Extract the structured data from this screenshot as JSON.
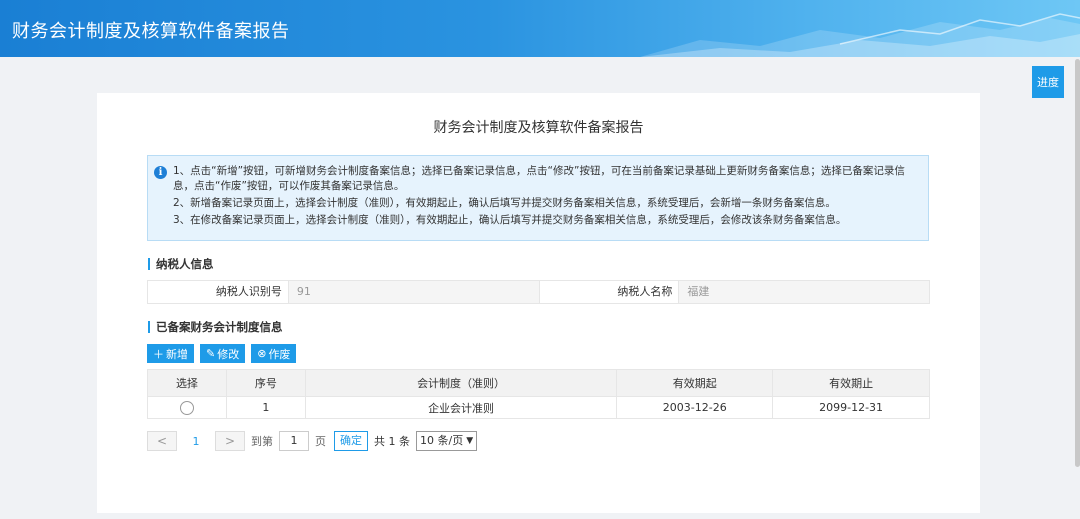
{
  "header": {
    "title": "财务会计制度及核算软件备案报告"
  },
  "progress_label": "进度",
  "panel": {
    "title": "财务会计制度及核算软件备案报告"
  },
  "notice": {
    "lines": [
      "1、点击“新增”按钮，可新增财务会计制度备案信息；选择已备案记录信息，点击“修改”按钮，可在当前备案记录基础上更新财务备案信息；选择已备案记录信息，点击“作废”按钮，可以作废其备案记录信息。",
      "2、新增备案记录页面上，选择会计制度（准则），有效期起止，确认后填写并提交财务备案相关信息，系统受理后，会新增一条财务备案信息。",
      "3、在修改备案记录页面上，选择会计制度（准则），有效期起止，确认后填写并提交财务备案相关信息，系统受理后，会修改该条财务备案信息。"
    ]
  },
  "taxpayer": {
    "section_title": "纳税人信息",
    "id_label": "纳税人识别号",
    "id_value": "91",
    "name_label": "纳税人名称",
    "name_value": "福建"
  },
  "records": {
    "section_title": "已备案财务会计制度信息",
    "add_label": "新增",
    "edit_label": "修改",
    "void_label": "作废",
    "columns": [
      "选择",
      "序号",
      "会计制度（准则）",
      "有效期起",
      "有效期止"
    ],
    "rows": [
      {
        "seq": "1",
        "standard": "企业会计准则",
        "start": "2003-12-26",
        "end": "2099-12-31"
      }
    ]
  },
  "pager": {
    "prev": "<",
    "next": ">",
    "current": "1",
    "goto_label": "到第",
    "goto_value": "1",
    "page_unit": "页",
    "confirm": "确定",
    "total": "共 1 条",
    "page_size": "10 条/页"
  }
}
